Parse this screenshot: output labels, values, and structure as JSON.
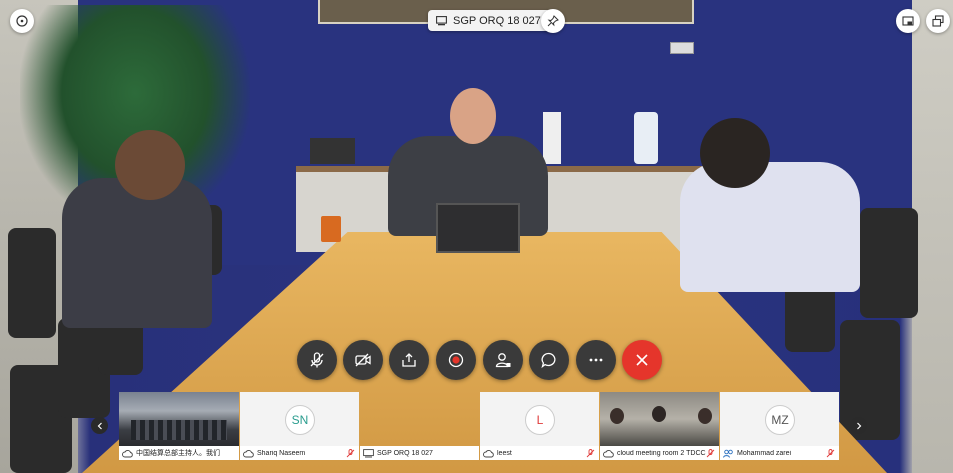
{
  "meeting": {
    "room_name": "SGP ORQ 18 027"
  },
  "controls": [
    {
      "name": "mute-mic-button",
      "icon": "mic-off-icon"
    },
    {
      "name": "stop-video-button",
      "icon": "camera-off-icon"
    },
    {
      "name": "share-screen-button",
      "icon": "share-icon"
    },
    {
      "name": "record-button",
      "icon": "record-icon"
    },
    {
      "name": "participants-button",
      "icon": "participants-icon"
    },
    {
      "name": "chat-button",
      "icon": "chat-icon"
    },
    {
      "name": "more-button",
      "icon": "more-icon"
    },
    {
      "name": "leave-button",
      "icon": "close-icon"
    }
  ],
  "participants": [
    {
      "label": "中国结算总部主持人。我们",
      "initials": "",
      "type": "video"
    },
    {
      "label": "Shariq Naseem",
      "initials": "SN",
      "type": "avatar",
      "color": "#2a9d8f"
    },
    {
      "label": "SGP ORQ 18 027",
      "initials": "",
      "type": "blank"
    },
    {
      "label": "leest",
      "initials": "L",
      "type": "avatar",
      "color": "#e03b3b"
    },
    {
      "label": "cloud meeting room 2 TDCC",
      "initials": "",
      "type": "video"
    },
    {
      "label": "Mohammad zarei",
      "initials": "MZ",
      "type": "avatar",
      "color": "#555555"
    }
  ],
  "colors": {
    "end_call": "#e5352b",
    "control_bg": "#3a3a3a",
    "mic_muted": "#e03b3b"
  }
}
